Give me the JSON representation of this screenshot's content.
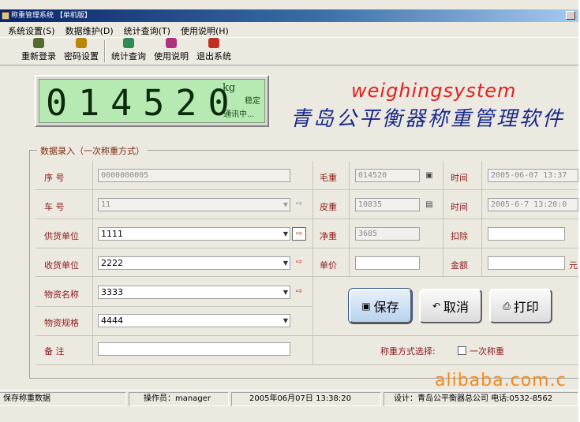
{
  "window": {
    "title": "称重管理系统 【单机版】"
  },
  "menu": [
    {
      "label": "系统设置(S)"
    },
    {
      "label": "数据维护(D)"
    },
    {
      "label": "统计查询(T)"
    },
    {
      "label": "使用说明(H)"
    }
  ],
  "toolbar": [
    {
      "label": "重新登录",
      "icon": "relogin-icon",
      "color": "#556b2f"
    },
    {
      "label": "密码设置",
      "icon": "password-icon",
      "color": "#b8860b"
    },
    {
      "label": "统计查询",
      "icon": "statistics-icon",
      "color": "#2e8b57"
    },
    {
      "label": "使用说明",
      "icon": "help-book-icon",
      "color": "#b03080"
    },
    {
      "label": "退出系统",
      "icon": "exit-icon",
      "color": "#c03020"
    }
  ],
  "scale": {
    "reading": "014520",
    "unit": "kg",
    "stable": "稳定",
    "comm_status": "通讯中..."
  },
  "brand": {
    "english": "weighingsystem",
    "chinese": "青岛公平衡器称重管理软件",
    "en_color": "#e02020",
    "cn_color": "#1a2a8a"
  },
  "entry": {
    "title": "数据录入（一次称重方式）",
    "serial_label": "序    号",
    "serial_value": "0000000005",
    "truck_label": "车    号",
    "truck_value": "11",
    "supplier_label": "供货单位",
    "supplier_value": "1111",
    "receiver_label": "收货单位",
    "receiver_value": "2222",
    "material_label": "物资名称",
    "material_value": "3333",
    "spec_label": "物资规格",
    "spec_value": "4444",
    "remark_label": "备    注",
    "remark_value": "",
    "gross_label": "毛重",
    "gross_value": "014520",
    "tare_label": "皮重",
    "tare_value": "10835",
    "net_label": "净重",
    "net_value": "3685",
    "price_label": "单价",
    "price_value": "",
    "time1_label": "时间",
    "time1_value": "2005-06-07 13:37",
    "time2_label": "时间",
    "time2_value": "2005-6-7 13:20:0",
    "deduct_label": "扣除",
    "deduct_value": "",
    "amount_label": "金额",
    "amount_value": "",
    "amount_unit": "元"
  },
  "actions": {
    "save": "保存",
    "cancel": "取消",
    "print": "打印"
  },
  "method": {
    "label": "称重方式选择:",
    "option": "一次称重",
    "checked": false
  },
  "watermark": "alibaba.com.c",
  "status": {
    "message": "保存称重数据",
    "operator": "操作员：manager",
    "datetime": "2005年06月07日  13:38:20",
    "designer": "设计：青岛公平衡器总公司  电话:0532-8562"
  }
}
